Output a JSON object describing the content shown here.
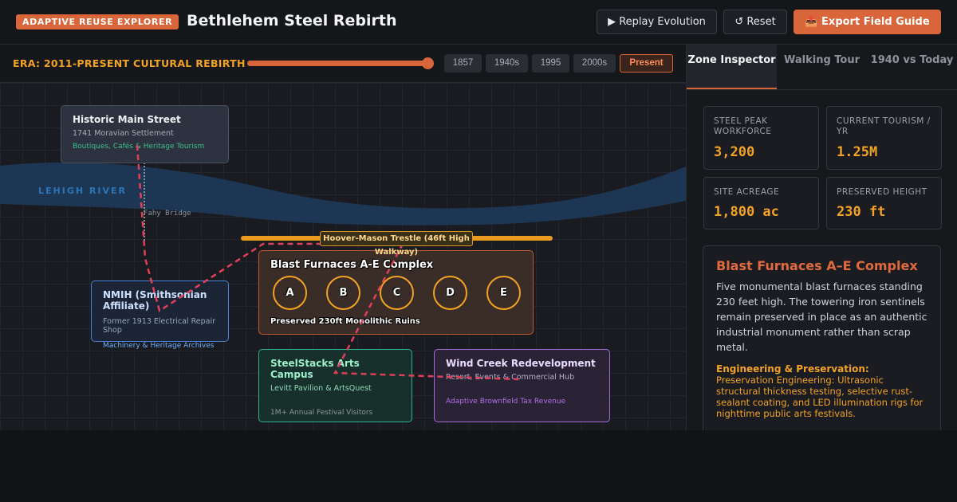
{
  "header": {
    "badge": "ADAPTIVE REUSE EXPLORER",
    "title": "Bethlehem Steel Rebirth",
    "replay_label": "▶ Replay Evolution",
    "reset_label": "↺ Reset",
    "export_label": "📤 Export Field Guide"
  },
  "era": {
    "label": "ERA: 2011-PRESENT CULTURAL REBIRTH",
    "slider_fraction": 0.99,
    "buttons": [
      "1857",
      "1940s",
      "1995",
      "2000s",
      "Present"
    ],
    "active": "Present"
  },
  "map": {
    "river_label": "LEHIGH RIVER",
    "bridge_label": "Fahy Bridge",
    "trestle_label": "Hoover-Mason Trestle (46ft High Walkway)",
    "zones": {
      "main": {
        "title": "Historic Main Street",
        "subtitle": "1741 Moravian Settlement",
        "detail": "Boutiques, Cafés & Heritage Tourism"
      },
      "nmih": {
        "title": "NMIH (Smithsonian Affiliate)",
        "subtitle": "Former 1913 Electrical Repair Shop",
        "detail": "Machinery & Heritage Archives"
      },
      "blast": {
        "title": "Blast Furnaces A-E Complex",
        "footer": "Preserved 230ft Monolithic Ruins",
        "furnaces": [
          "A",
          "B",
          "C",
          "D",
          "E"
        ]
      },
      "steelstacks": {
        "title": "SteelStacks Arts Campus",
        "subtitle": "Levitt Pavilion & ArtsQuest",
        "detail": "1M+ Annual Festival Visitors"
      },
      "windcreek": {
        "title": "Wind Creek Redevelopment",
        "subtitle": "Resort, Events & Commercial Hub",
        "detail": "Adaptive Brownfield Tax Revenue"
      }
    }
  },
  "panel": {
    "tabs": [
      "Zone Inspector",
      "Walking Tour",
      "1940 vs Today"
    ],
    "active_tab": "Zone Inspector",
    "stats": [
      {
        "label": "STEEL PEAK WORKFORCE",
        "value": "3,200"
      },
      {
        "label": "CURRENT TOURISM / YR",
        "value": "1.25M"
      },
      {
        "label": "SITE ACREAGE",
        "value": "1,800 ac"
      },
      {
        "label": "PRESERVED HEIGHT",
        "value": "230 ft"
      }
    ],
    "detail": {
      "title": "Blast Furnaces A–E Complex",
      "description": "Five monumental blast furnaces standing 230 feet high. The towering iron sentinels remain preserved in place as an authentic industrial monument rather than scrap metal.",
      "eng_heading": "Engineering & Preservation:",
      "eng_text": "Preservation Engineering: Ultrasonic structural thickness testing, selective rust-sealant coating, and LED illumination rigs for nighttime public arts festivals."
    }
  },
  "colors": {
    "accent": "#d9653b",
    "gold": "#f2a324",
    "river": "#1f3b5e",
    "tour_path": "#e0405a"
  }
}
